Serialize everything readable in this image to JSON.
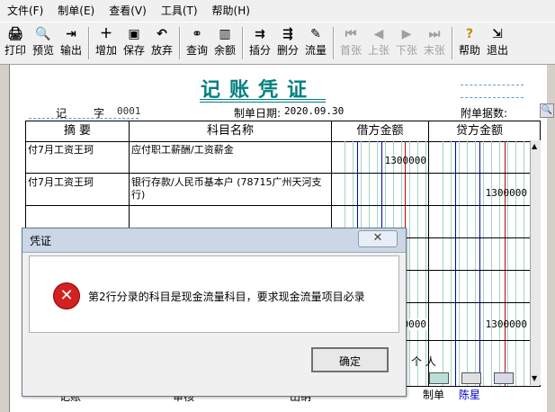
{
  "menu": [
    "文件(F)",
    "制单(E)",
    "查看(V)",
    "工具(T)",
    "帮助(H)"
  ],
  "toolbar": {
    "print": "打印",
    "preview": "预览",
    "export": "输出",
    "add": "增加",
    "save": "保存",
    "discard": "放弃",
    "query": "查询",
    "balance": "余额",
    "insert": "插分",
    "delete": "删分",
    "flow": "流量",
    "first": "首张",
    "prev": "上张",
    "next": "下张",
    "last": "末张",
    "help": "帮助",
    "exit": "退出"
  },
  "voucher": {
    "title": "记账凭证",
    "type_label": "记",
    "word_label": "字",
    "number": "0001",
    "date_label": "制单日期:",
    "date": "2020.09.30",
    "attachments_label": "附单据数:",
    "columns": {
      "summary": "摘  要",
      "account": "科目名称",
      "debit": "借方金额",
      "credit": "贷方金额"
    },
    "rows": [
      {
        "summary": "付7月工资王珂",
        "account": "应付职工薪酬/工资薪金",
        "debit": "1300000",
        "credit": ""
      },
      {
        "summary": "付7月工资王珂",
        "account": "银行存款/人民币基本户 (78715广州天河支行)",
        "debit": "",
        "credit": "1300000"
      }
    ],
    "total_debit": "0000",
    "total_credit": "1300000",
    "personal_label": "个 人",
    "footer": {
      "bookkeeping": "记账",
      "review": "审核",
      "cashier": "出纳",
      "maker_label": "制单",
      "maker": "陈星"
    }
  },
  "dialog": {
    "title": "凭证",
    "message": "第2行分录的科目是现金流量科目，要求现金流量项目必录",
    "ok": "确定"
  }
}
